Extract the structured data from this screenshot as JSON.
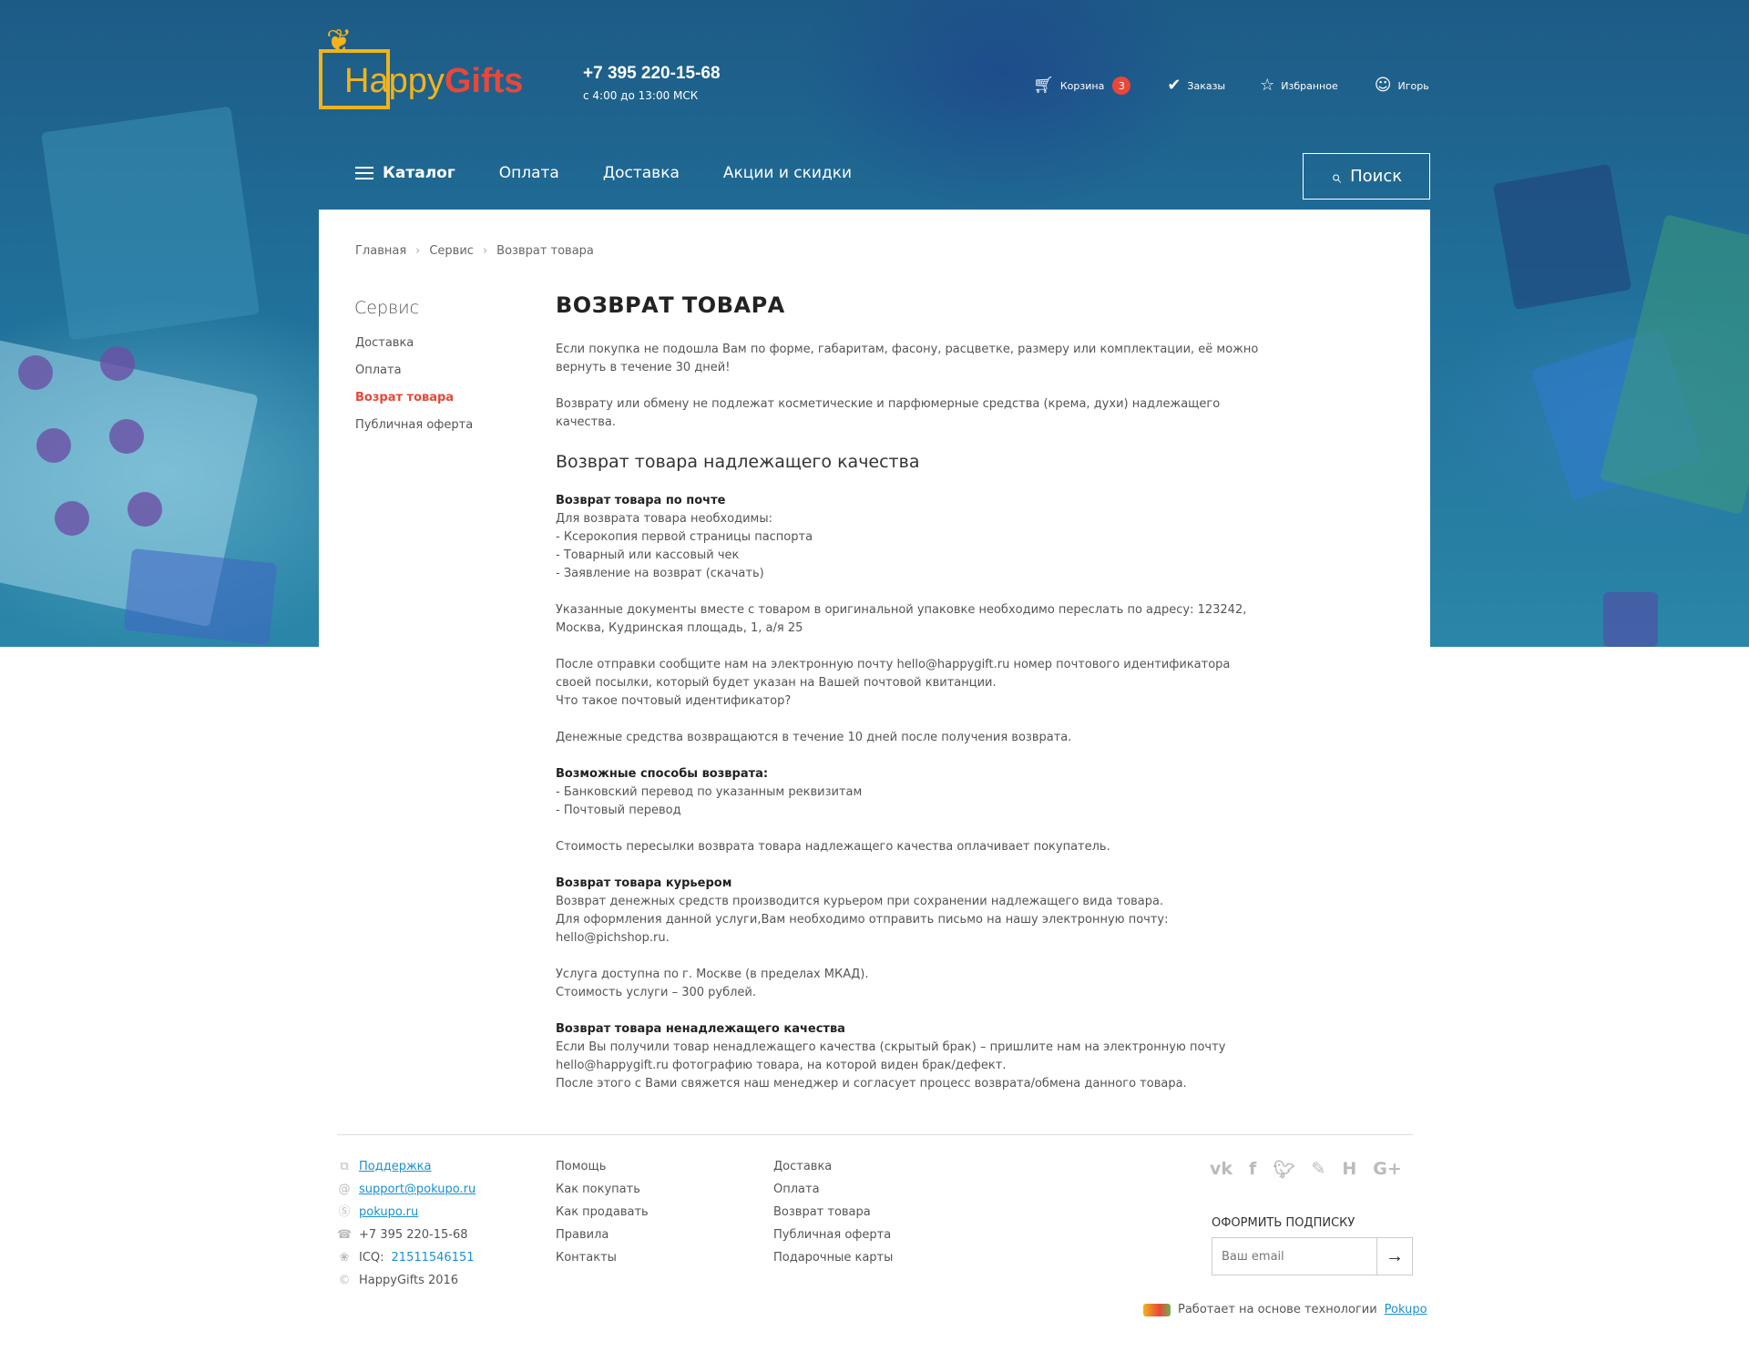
{
  "header": {
    "logo_happy": "Happy",
    "logo_gifts": "Gifts",
    "phone": "+7 395 220-15-68",
    "hours": "с 4:00 до 13:00 МСК",
    "cart_label": "Корзина",
    "cart_count": "3",
    "orders_label": "Заказы",
    "favorites_label": "Избранное",
    "user_label": "Игорь"
  },
  "nav": {
    "catalog": "Каталог",
    "payment": "Оплата",
    "delivery": "Доставка",
    "promo": "Акции и скидки",
    "search": "Поиск"
  },
  "breadcrumb": [
    "Главная",
    "Сервис",
    "Возврат товара"
  ],
  "sidebar": {
    "title": "Сервис",
    "items": [
      {
        "label": "Доставка"
      },
      {
        "label": "Оплата"
      },
      {
        "label": "Возрат товара"
      },
      {
        "label": "Публичная оферта"
      }
    ]
  },
  "content": {
    "title": "ВОЗВРАТ ТОВАРА",
    "p1": "Если покупка не подошла Вам по форме, габаритам, фасону, расцветке, размеру или комплектации, её можно вернуть в течение 30 дней!",
    "p2": "Возврату или обмену не подлежат косметические и парфюмерные средства (крема, духи) надлежащего качества.",
    "h2": "Возврат товара надлежащего качества",
    "mail_title": "Возврат товара по почте",
    "mail_l1": "Для возврата товара необходимы:",
    "mail_l2": "- Ксерокопия первой страницы паспорта",
    "mail_l3": "- Товарный или кассовый чек",
    "mail_l4": "- Заявление на возврат (скачать)",
    "p3": "Указанные документы вместе с товаром в оригинальной упаковке необходимо переслать по адресу: 123242, Москва, Кудринская площадь, 1, а/я 25",
    "p4a": "После отправки сообщите нам на электронную почту hello@happygift.ru номер почтового идентификатора своей посылки, который будет указан на Вашей почтовой квитанции.",
    "p4b": "Что такое почтовый идентификатор?",
    "p5": "Денежные средства возвращаются в течение 10 дней после получения возврата.",
    "ways_title": "Возможные способы возврата:",
    "ways_l1": "- Банковский перевод по указанным реквизитам",
    "ways_l2": "- Почтовый перевод",
    "p6": "Стоимость пересылки возврата товара надлежащего качества оплачивает покупатель.",
    "courier_title": "Возврат товара курьером",
    "courier_l1": "Возврат денежных средств производится курьером при сохранении надлежащего вида товара.",
    "courier_l2": "Для оформления данной услуги,Вам необходимо отправить письмо на нашу электронную почту: hello@pichshop.ru.",
    "p7a": "Услуга доступна по г. Москве (в пределах МКАД).",
    "p7b": "Стоимость услуги – 300 рублей.",
    "bad_title": "Возврат товара ненадлежащего качества",
    "bad_l1": "Если Вы получили товар ненадлежащего качества (скрытый брак) – пришлите нам на электронную почту hello@happygift.ru фотографию товара, на которой виден брак/дефект.",
    "bad_l2": "После этого с Вами свяжется наш менеджер и согласует процесс возврата/обмена данного товара."
  },
  "footer": {
    "contacts": {
      "support": "Поддержка",
      "email": "support@pokupo.ru",
      "skype": "pokupo.ru",
      "phone": "+7 395 220-15-68",
      "icq_label": "ICQ:",
      "icq_value": "21511546151",
      "copyright": "HappyGifts 2016"
    },
    "col2": [
      "Помощь",
      "Как покупать",
      "Как продавать",
      "Правила",
      "Контакты"
    ],
    "col3": [
      "Доставка",
      "Оплата",
      "Возврат товара",
      "Публичная оферта",
      "Подарочные карты"
    ],
    "socials": [
      "vk-icon",
      "facebook-icon",
      "twitter-icon",
      "livejournal-icon",
      "habr-icon",
      "google-plus-icon"
    ],
    "subscribe_title": "ОФОРМИТЬ ПОДПИСКУ",
    "subscribe_placeholder": "Ваш email",
    "powered_text": "Работает на основе технологии",
    "powered_link": "Pokupo"
  }
}
